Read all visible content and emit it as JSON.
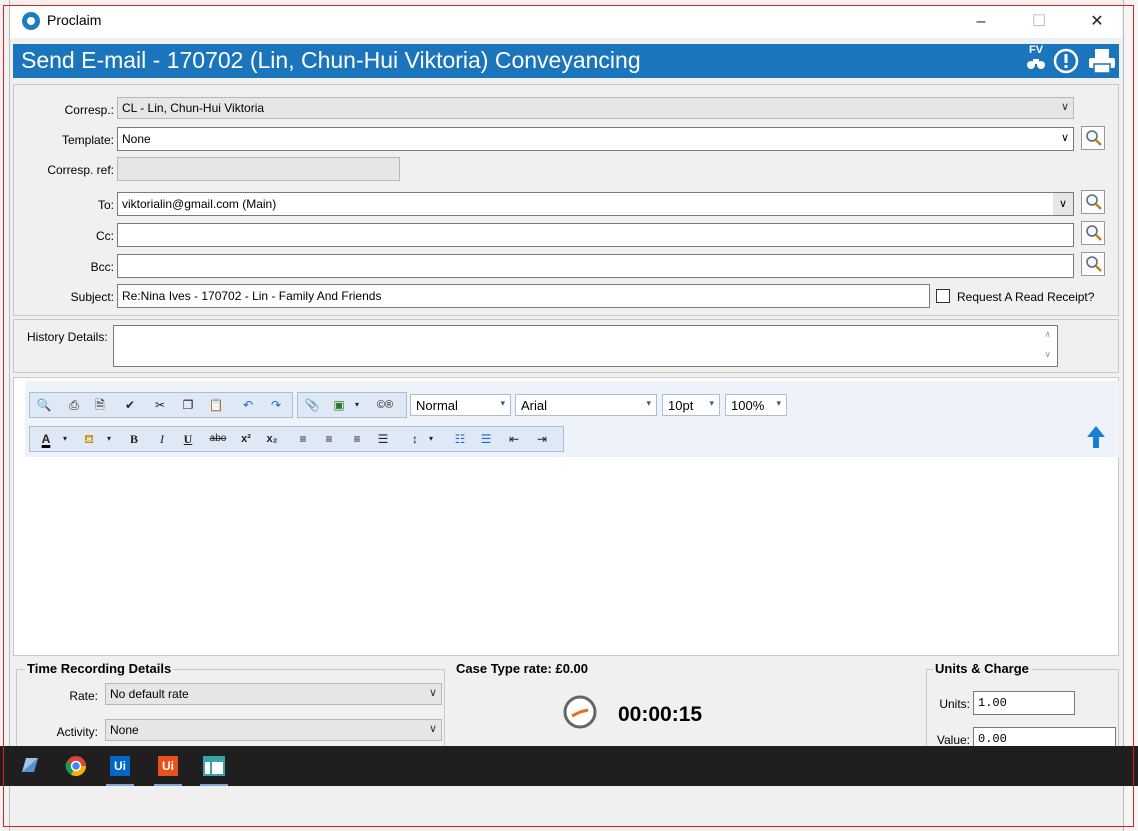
{
  "window": {
    "title": "Proclaim",
    "minimize_glyph": "–",
    "maximize_glyph": "☐",
    "close_glyph": "✕"
  },
  "header": {
    "title": "Send E-mail - 170702 (Lin, Chun-Hui Viktoria) Conveyancing",
    "fv_label": "FV",
    "icons": [
      "binoculars-icon",
      "info-icon",
      "printer-icon"
    ]
  },
  "form": {
    "corresp": {
      "label": "Corresp.:",
      "value": "CL - Lin, Chun-Hui Viktoria"
    },
    "template": {
      "label": "Template:",
      "value": "None"
    },
    "corresp_ref": {
      "label": "Corresp. ref:",
      "value": ""
    },
    "to": {
      "label": "To:",
      "value": "viktorialin@gmail.com (Main)"
    },
    "cc": {
      "label": "Cc:",
      "value": ""
    },
    "bcc": {
      "label": "Bcc:",
      "value": ""
    },
    "subject": {
      "label": "Subject:",
      "value": "Re:Nina Ives - 170702 - Lin - Family And Friends"
    },
    "read_receipt": {
      "label": "Request A Read Receipt?",
      "checked": false
    }
  },
  "history": {
    "label": "History Details:",
    "value": ""
  },
  "editor": {
    "style": "Normal",
    "font": "Arial",
    "size": "10pt",
    "zoom": "100%",
    "bold": "B",
    "italic": "I",
    "underline": "U",
    "strike": "abo",
    "superscript": "x²",
    "subscript": "x₂"
  },
  "time_recording": {
    "title": "Time Recording Details",
    "rate_label": "Rate:",
    "rate_value": "No default rate",
    "activity_label": "Activity:",
    "activity_value": "None"
  },
  "case_type_rate": "Case Type rate: £0.00",
  "timer": "00:00:15",
  "units_charge": {
    "title": "Units & Charge",
    "units_label": "Units:",
    "units_value": "1.00",
    "value_label": "Value:",
    "value_value": "0.00"
  },
  "taskbar": {
    "ui_label_1": "Ui",
    "ui_label_2": "Ui"
  },
  "colors": {
    "header_blue": "#1b75bc",
    "accent_red": "#e0201f",
    "uipath_blue": "#0067c5",
    "uipath_orange": "#e8501c"
  }
}
